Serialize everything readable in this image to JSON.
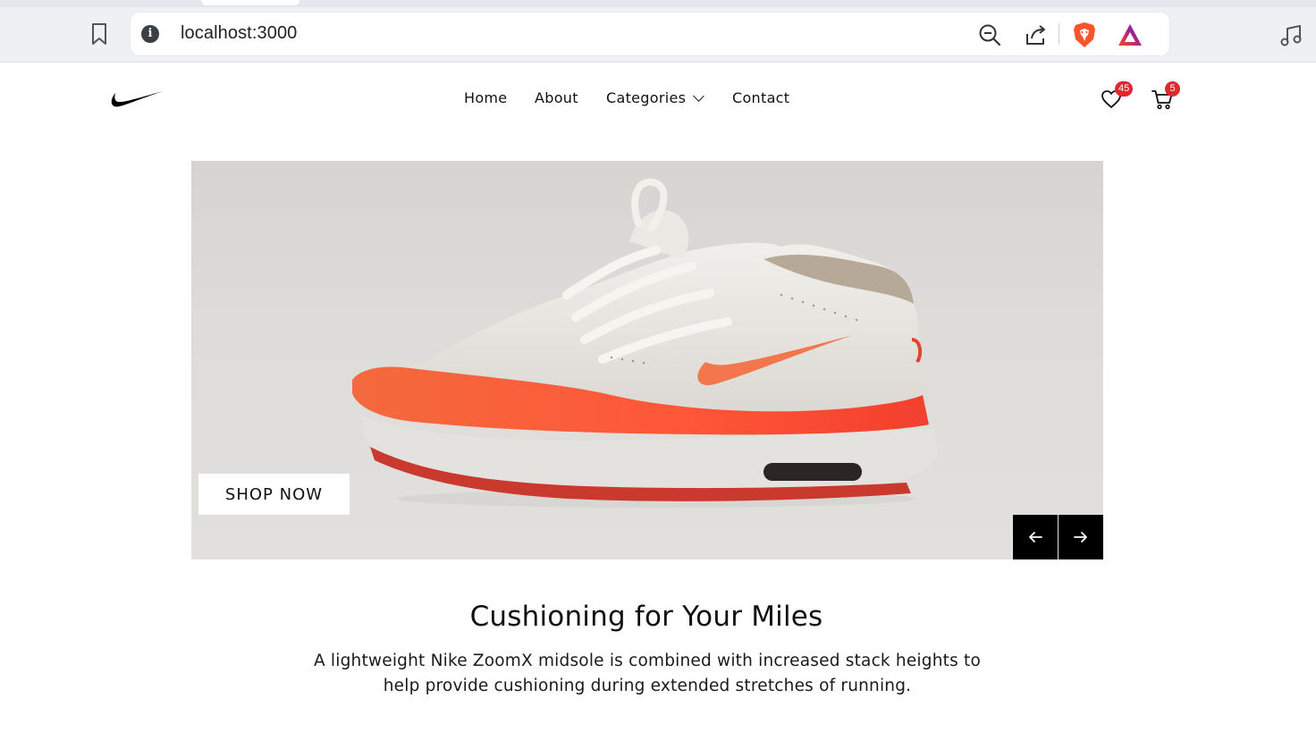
{
  "browser": {
    "url": "localhost:3000",
    "icons": [
      "bookmark-icon",
      "site-info-icon",
      "zoom-out-icon",
      "share-icon",
      "brave-shields-icon",
      "brave-rewards-icon",
      "media-icon"
    ],
    "colors": {
      "shields": "#fb542b",
      "rewards_a": "#ff4724",
      "rewards_b": "#6a1fd6"
    }
  },
  "header": {
    "logo": "nike-swoosh",
    "nav": {
      "home": "Home",
      "about": "About",
      "categories": "Categories",
      "contact": "Contact"
    },
    "wishlist_count": "45",
    "cart_count": "5",
    "badge_color": "#e0262f"
  },
  "hero": {
    "image": "white-and-orange-running-shoe",
    "cta_label": "SHOP NOW",
    "prev_icon": "arrow-left-icon",
    "next_icon": "arrow-right-icon"
  },
  "feature": {
    "title": "Cushioning for Your Miles",
    "description": "A lightweight Nike ZoomX midsole is combined with increased stack heights to help provide cushioning during extended stretches of running."
  }
}
